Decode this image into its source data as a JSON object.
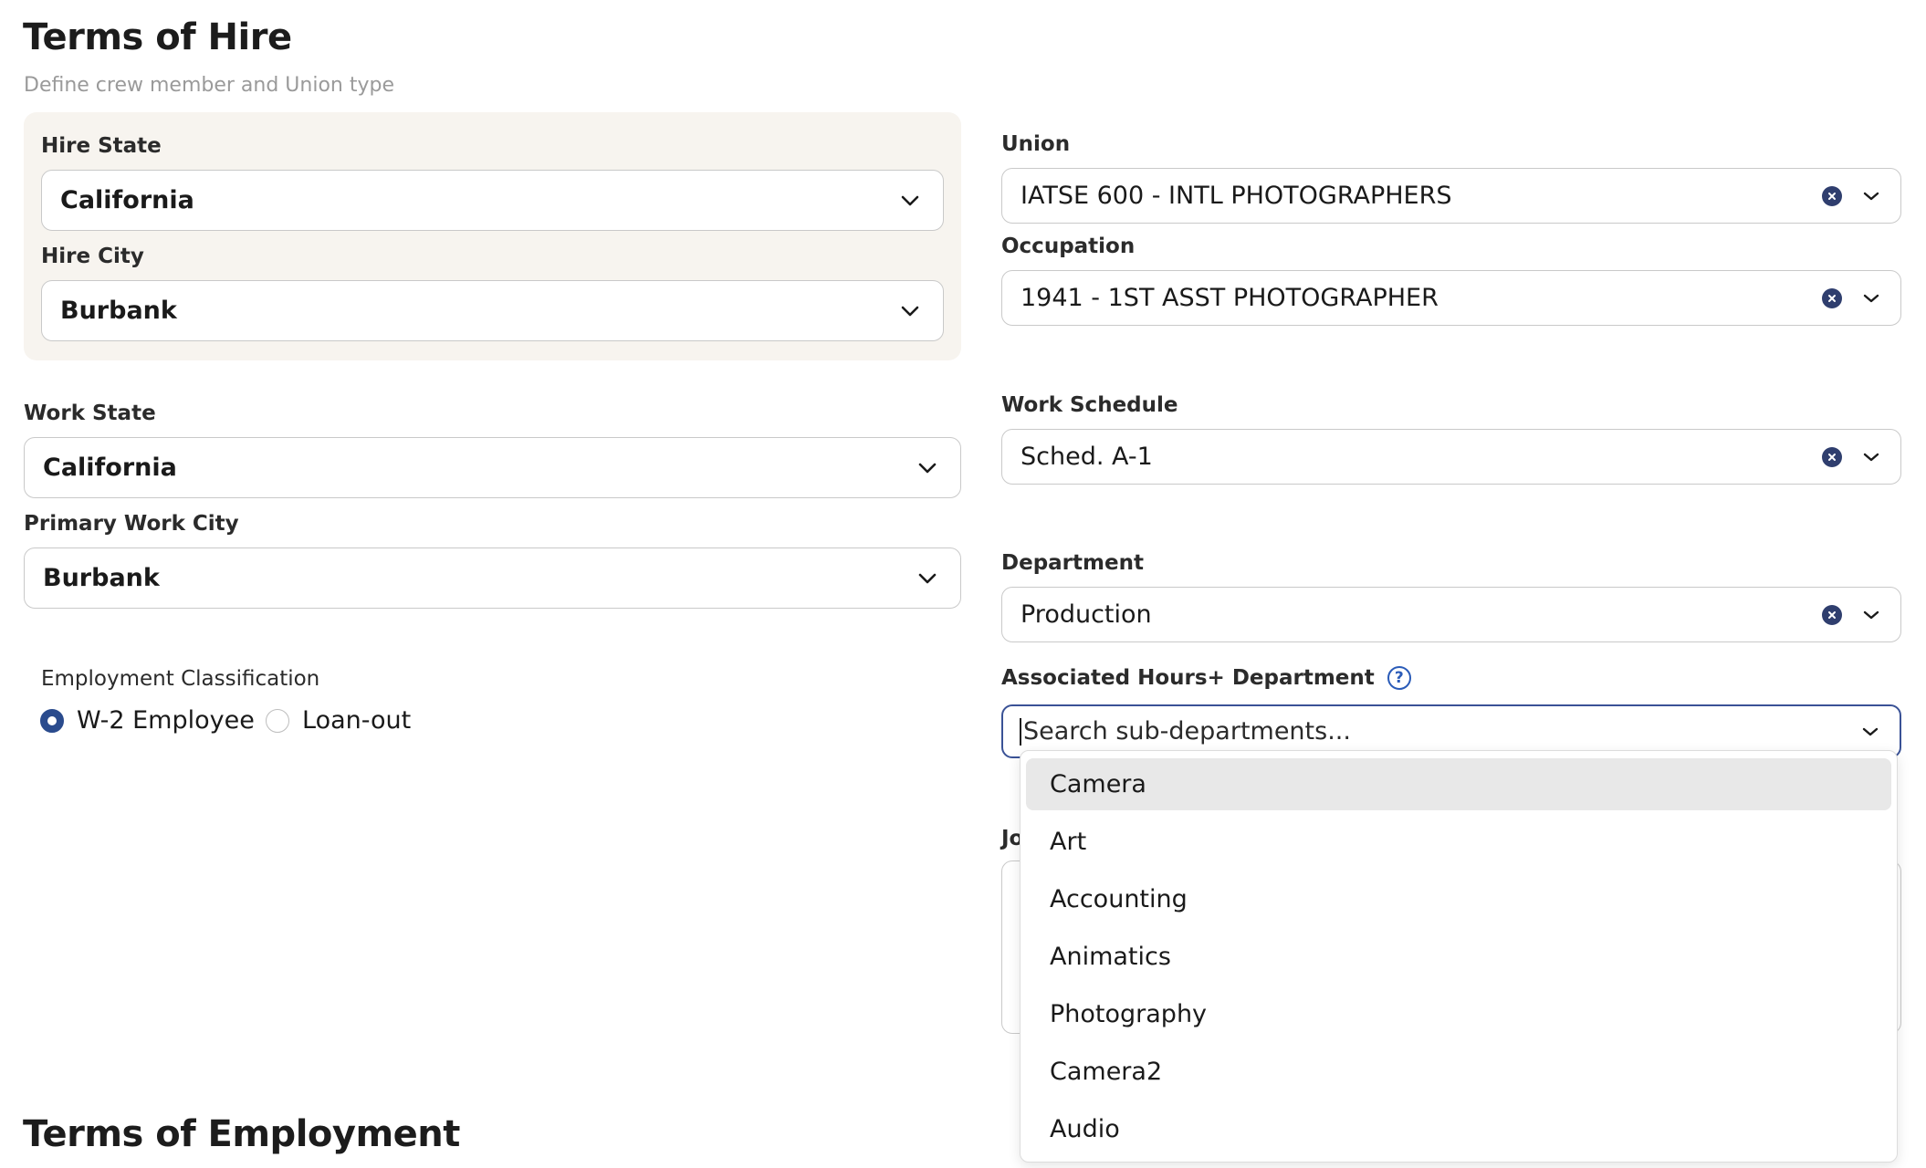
{
  "terms_of_hire": {
    "title": "Terms of Hire",
    "subtitle": "Define crew member and Union type"
  },
  "hire_state": {
    "label": "Hire State",
    "value": "California"
  },
  "hire_city": {
    "label": "Hire City",
    "value": "Burbank"
  },
  "work_state": {
    "label": "Work State",
    "value": "California"
  },
  "primary_work_city": {
    "label": "Primary Work City",
    "value": "Burbank"
  },
  "employment_classification": {
    "label": "Employment Classification",
    "options": [
      {
        "label": "W-2 Employee",
        "checked": true
      },
      {
        "label": "Loan-out",
        "checked": false
      }
    ]
  },
  "union": {
    "label": "Union",
    "value": "IATSE 600 - INTL PHOTOGRAPHERS"
  },
  "occupation": {
    "label": "Occupation",
    "value": "1941 - 1ST ASST PHOTOGRAPHER"
  },
  "work_schedule": {
    "label": "Work Schedule",
    "value": "Sched. A-1"
  },
  "department": {
    "label": "Department",
    "value": "Production"
  },
  "associated_department": {
    "label": "Associated Hours+ Department",
    "placeholder": "Search sub-departments...",
    "options": [
      "Camera",
      "Art",
      "Accounting",
      "Animatics",
      "Photography",
      "Camera2",
      "Audio"
    ],
    "highlighted": "Camera"
  },
  "obscured_label_fragment": "Jo",
  "terms_of_employment": {
    "title": "Terms of Employment"
  },
  "icons": {
    "chevron": "chevron-down-icon",
    "clear": "clear-x-icon",
    "help": "help-question-icon"
  },
  "colors": {
    "accent": "#2a4b8d",
    "focus_border": "#3a5296",
    "hire_box_bg": "#f7f4ef",
    "highlight_bg": "#e8e8e8"
  }
}
